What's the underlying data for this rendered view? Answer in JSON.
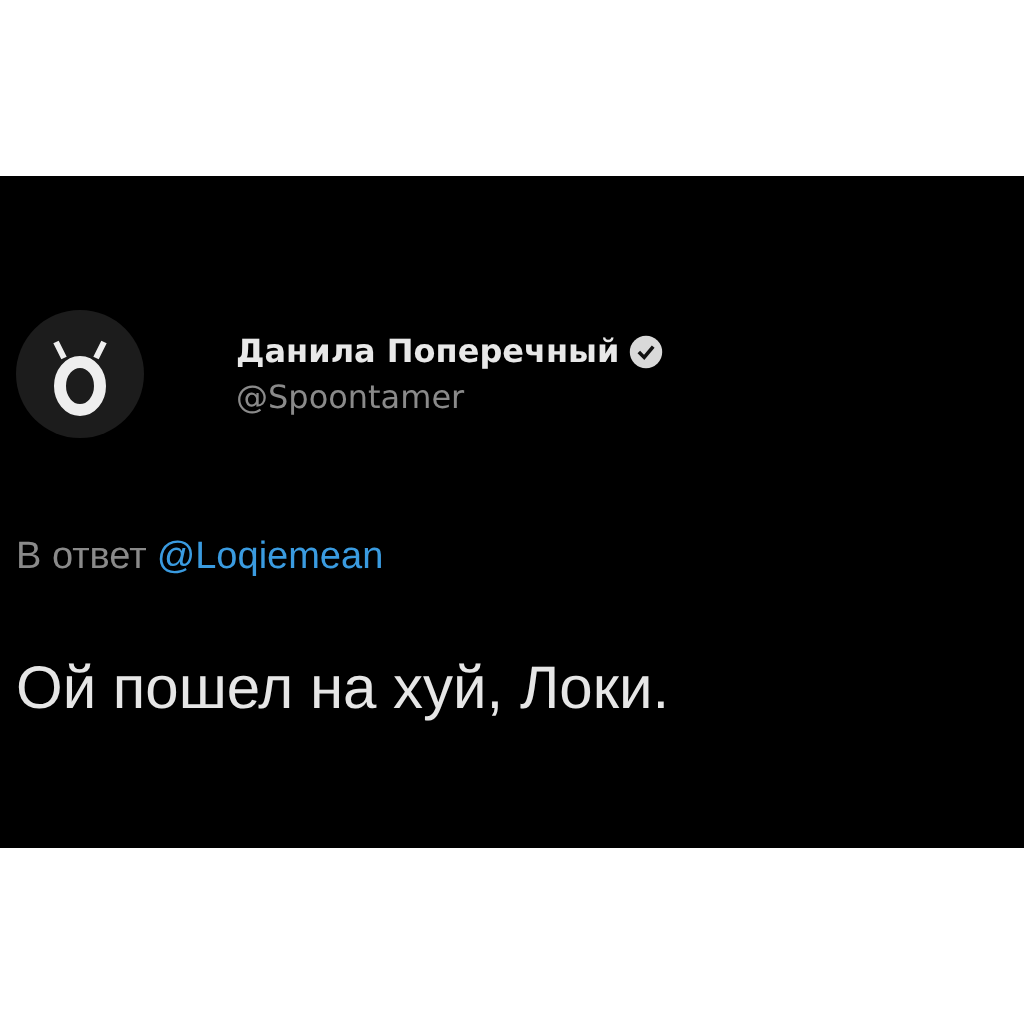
{
  "tweet": {
    "author": {
      "name": "Данила Поперечный",
      "verified": true,
      "handle": "@Spoontamer"
    },
    "reply_to": {
      "prefix": "В ответ",
      "handle": "@Loqiemean"
    },
    "text": "Ой пошел на хуй, Локи."
  }
}
